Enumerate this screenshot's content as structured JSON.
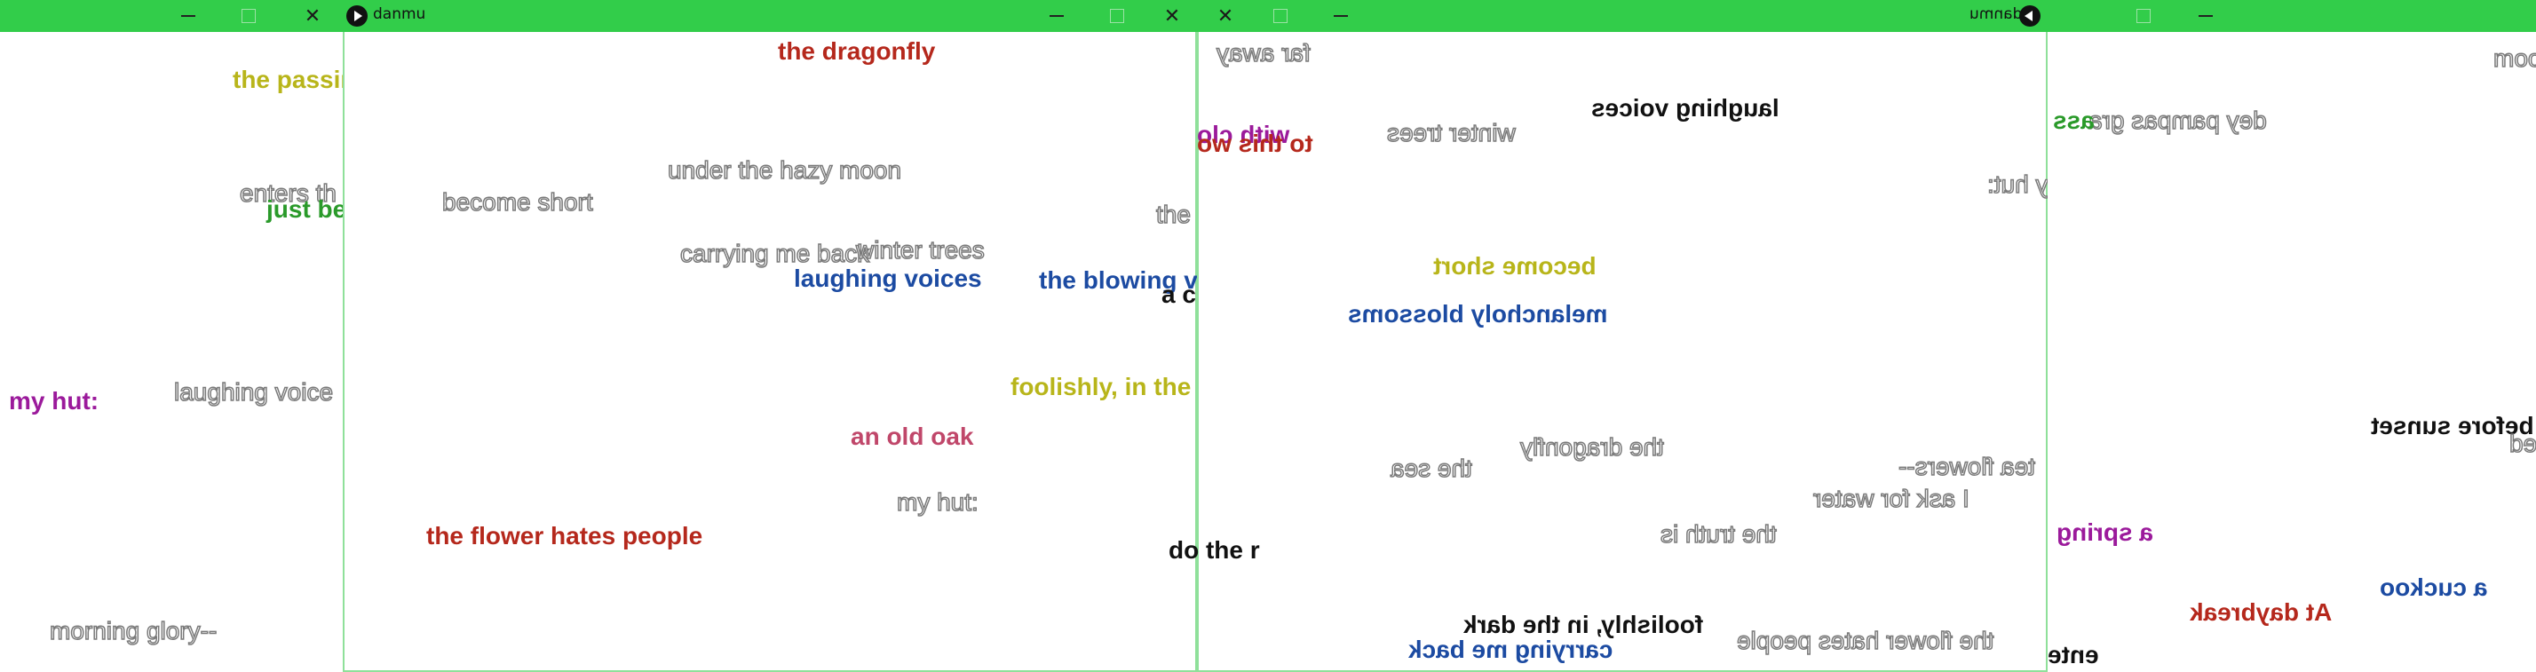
{
  "app_title": "danmu",
  "far_left": {
    "danmu": [
      {
        "text": "the passin",
        "style": "olive"
      },
      {
        "text": "enters th",
        "style": "outline"
      },
      {
        "text": "just be",
        "style": "green"
      },
      {
        "text": "my hut:",
        "style": "purple"
      },
      {
        "text": "laughing voice",
        "style": "outline"
      },
      {
        "text": "morning glory--",
        "style": "outline"
      }
    ]
  },
  "window1": {
    "title": "danmu",
    "danmu": [
      {
        "text": "the dragonfly",
        "style": "red"
      },
      {
        "text": "under the hazy moon",
        "style": "outline"
      },
      {
        "text": "become short",
        "style": "outline"
      },
      {
        "text": "the",
        "style": "outline"
      },
      {
        "text": "carrying me back",
        "style": "outline"
      },
      {
        "text": "winter trees",
        "style": "outline"
      },
      {
        "text": "laughing voices",
        "style": "blue"
      },
      {
        "text": "the blowing v",
        "style": "blue"
      },
      {
        "text": "a c",
        "style": "black"
      },
      {
        "text": "foolishly, in the",
        "style": "olive"
      },
      {
        "text": "an old oak",
        "style": "pink"
      },
      {
        "text": "my hut:",
        "style": "outline"
      },
      {
        "text": "the flower hates people",
        "style": "red"
      },
      {
        "text": "do the r",
        "style": "black"
      }
    ]
  },
  "window2": {
    "title": "danmu",
    "danmu": [
      {
        "text": "far away",
        "style": "outline"
      },
      {
        "text": "with clo",
        "style": "purple"
      },
      {
        "text": "to this wo",
        "style": "red"
      },
      {
        "text": "laughing voices",
        "style": "black"
      },
      {
        "text": "winter trees",
        "style": "outline"
      },
      {
        "text": "y hut:",
        "style": "outline"
      },
      {
        "text": "become short",
        "style": "olive"
      },
      {
        "text": "melancholy blossoms",
        "style": "blue"
      },
      {
        "text": "the dragonfly",
        "style": "outline"
      },
      {
        "text": "the sea",
        "style": "outline"
      },
      {
        "text": "tea flowers--",
        "style": "outline"
      },
      {
        "text": "I ask for water",
        "style": "outline"
      },
      {
        "text": "the truth is",
        "style": "outline"
      },
      {
        "text": "foolishly, in the dark",
        "style": "black"
      },
      {
        "text": "carrying me back",
        "style": "blue"
      },
      {
        "text": "the flower hates people",
        "style": "outline"
      }
    ]
  },
  "far_right": {
    "danmu": [
      {
        "text": "moo",
        "style": "outline"
      },
      {
        "text": "dey pampas gra",
        "style": "outline"
      },
      {
        "text": "ass",
        "style": "green"
      },
      {
        "text": "before sunset",
        "style": "black"
      },
      {
        "text": "ed",
        "style": "outline"
      },
      {
        "text": "a spring",
        "style": "purple"
      },
      {
        "text": "a cuckoo",
        "style": "blue"
      },
      {
        "text": "At daybreak",
        "style": "red"
      },
      {
        "text": "ente",
        "style": "black"
      }
    ]
  },
  "controls": {
    "minimize": "—",
    "maximize": "☐",
    "close": "✕"
  }
}
